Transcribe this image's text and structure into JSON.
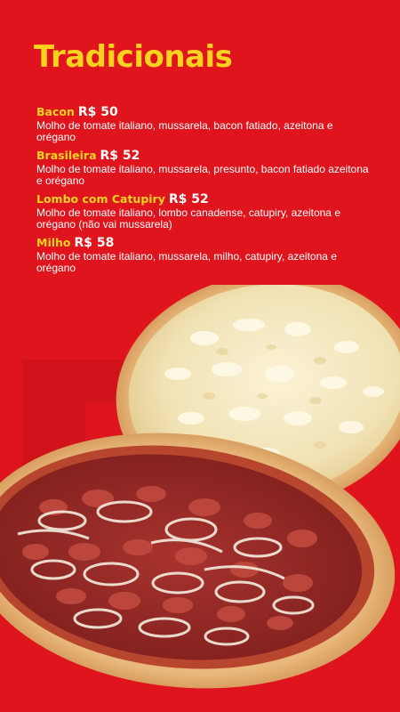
{
  "colors": {
    "background": "#e0141c",
    "accent_yellow": "#ffd21f",
    "text_white": "#ffffff"
  },
  "page": {
    "title": "Tradicionais",
    "background_letter": "B"
  },
  "menu": {
    "items": [
      {
        "name": "Bacon",
        "price": "R$ 50",
        "description": "Molho de tomate italiano, mussarela, bacon fatiado, azeitona e orégano"
      },
      {
        "name": "Brasileira",
        "price": "R$ 52",
        "description": "Molho de tomate italiano, mussarela, presunto, bacon fatiado azeitona e orégano"
      },
      {
        "name": "Lombo com Catupiry",
        "price": "R$ 52",
        "description": "Molho de tomate italiano, lombo canadense, catupiry, azeitona e orégano (não vai mussarela)"
      },
      {
        "name": "Milho",
        "price": "R$ 58",
        "description": "Molho de tomate italiano, mussarela, milho, catupiry, azeitona e orégano"
      }
    ]
  },
  "images": {
    "pizza_back": "cheese-pizza-photo",
    "pizza_front": "calabresa-onion-pizza-photo"
  }
}
